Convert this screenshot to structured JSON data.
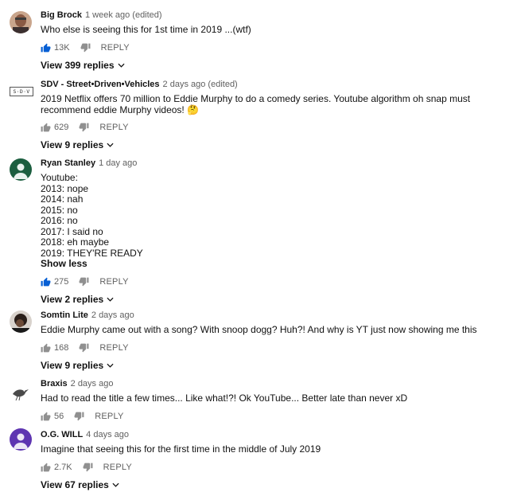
{
  "comments": [
    {
      "author": "Big Brock",
      "time": "1 week ago (edited)",
      "text": "Who else is seeing this for 1st time in 2019 ...(wtf)",
      "likes": "13K",
      "reply_label": "REPLY",
      "view_replies": "View 399 replies"
    },
    {
      "author": "SDV - Street•Driven•Vehicles",
      "time": "2 days ago (edited)",
      "text": "2019 Netflix offers 70 million to Eddie Murphy to do a comedy series. Youtube algorithm oh snap must recommend eddie Murphy videos! 🤔",
      "avatar_text": "S·D·V",
      "likes": "629",
      "reply_label": "REPLY",
      "view_replies": "View 9 replies"
    },
    {
      "author": "Ryan Stanley",
      "time": "1 day ago",
      "lines": [
        "Youtube:",
        "2013: nope",
        "2014: nah",
        "2015: no",
        "2016: no",
        "2017: I said no",
        "2018: eh maybe",
        "2019: THEY'RE READY"
      ],
      "show_less": "Show less",
      "likes": "275",
      "reply_label": "REPLY",
      "view_replies": "View 2 replies"
    },
    {
      "author": "Somtin Lite",
      "time": "2 days ago",
      "text": "Eddie Murphy came out with a song? With snoop dogg? Huh?! And why is YT just now showing me this",
      "likes": "168",
      "reply_label": "REPLY",
      "view_replies": "View 9 replies"
    },
    {
      "author": "Braxis",
      "time": "2 days ago",
      "text": "Had to read the title a few times... Like what!?!  Ok YouTube... Better late than never xD",
      "likes": "56",
      "reply_label": "REPLY"
    },
    {
      "author": "O.G. WILL",
      "time": "4 days ago",
      "text": "Imagine that seeing this for the first time in the middle of July 2019",
      "likes": "2.7K",
      "reply_label": "REPLY",
      "view_replies": "View 67 replies"
    }
  ],
  "colors": {
    "like_active": "#065fd4",
    "icon_inactive": "#909090",
    "avatar_ryan": "#1b5e3f",
    "avatar_og": "#5e35b1"
  },
  "icons": [
    "thumbs-up-icon",
    "thumbs-down-icon",
    "chevron-down-icon"
  ]
}
